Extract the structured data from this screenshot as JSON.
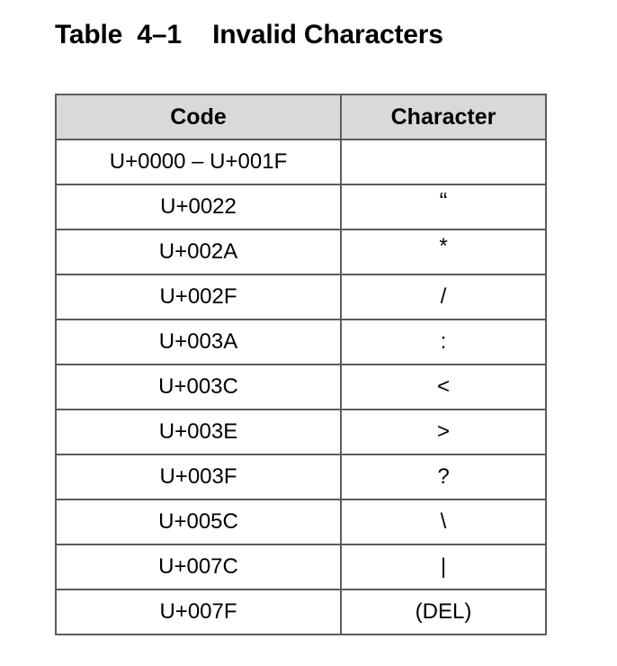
{
  "title": {
    "label": "Table",
    "number": "4–1",
    "name": "Invalid Characters",
    "full": "Table 4–1   Invalid Characters"
  },
  "table": {
    "headers": [
      "Code",
      "Character"
    ],
    "header_background": "#d9d9d9",
    "border_color": "#5c5c5c",
    "rows": [
      {
        "code": "U+0000 – U+001F",
        "character": ""
      },
      {
        "code": "U+0022",
        "character": "“"
      },
      {
        "code": "U+002A",
        "character": "*"
      },
      {
        "code": "U+002F",
        "character": "/"
      },
      {
        "code": "U+003A",
        "character": ":"
      },
      {
        "code": "U+003C",
        "character": "<"
      },
      {
        "code": "U+003E",
        "character": ">"
      },
      {
        "code": "U+003F",
        "character": "?"
      },
      {
        "code": "U+005C",
        "character": "\\"
      },
      {
        "code": "U+007C",
        "character": "|"
      },
      {
        "code": "U+007F",
        "character": "(DEL)"
      }
    ]
  }
}
